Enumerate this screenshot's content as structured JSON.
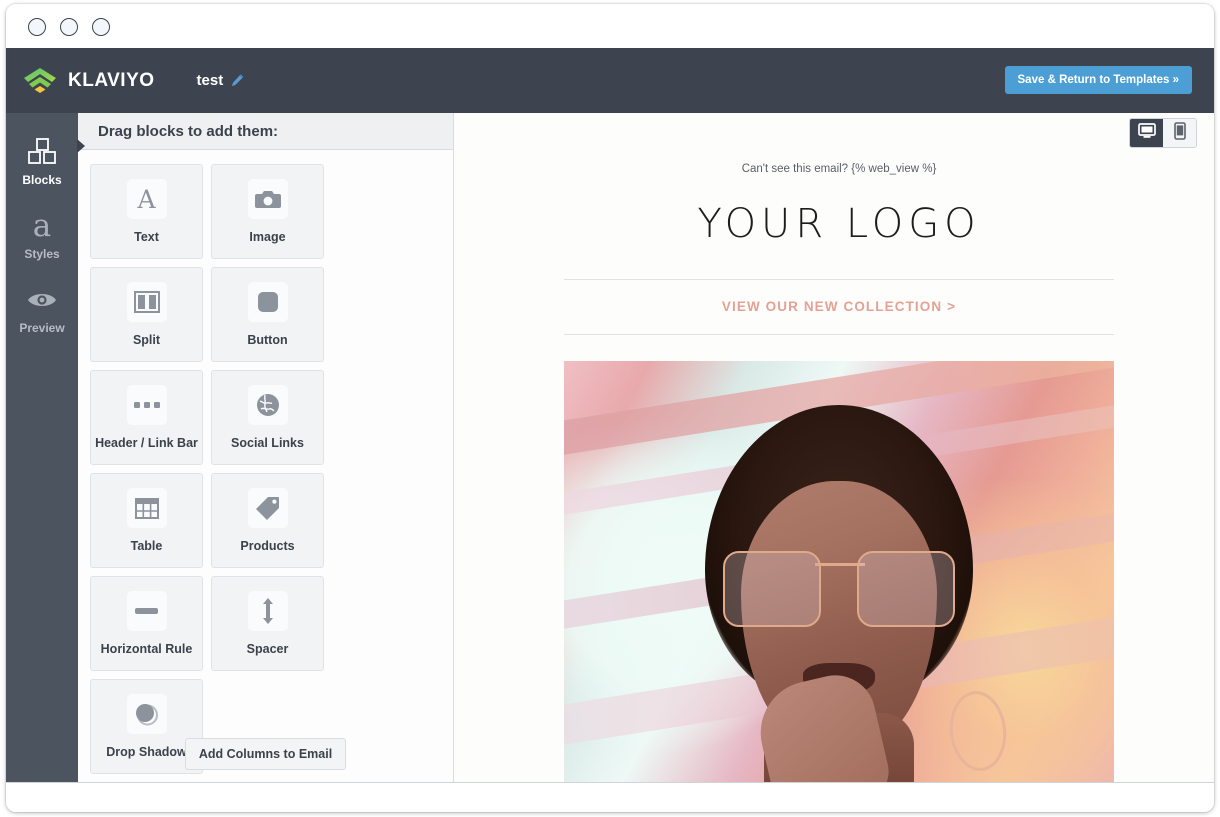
{
  "window": {
    "traffic_lights": [
      "close",
      "minimize",
      "maximize"
    ]
  },
  "appbar": {
    "brand_name": "KLAVIYO",
    "document_name": "test",
    "edit_icon": "pencil-icon",
    "save_label": "Save & Return to Templates »",
    "save_color": "#4b9fd5",
    "background": "#3d444f"
  },
  "rail": {
    "items": [
      {
        "label": "Blocks",
        "icon": "blocks-icon",
        "active": true
      },
      {
        "label": "Styles",
        "icon": "letter-a-icon",
        "active": false
      },
      {
        "label": "Preview",
        "icon": "eye-icon",
        "active": false
      }
    ]
  },
  "panel": {
    "title": "Drag blocks to add them:",
    "add_columns_label": "Add Columns to Email",
    "blocks": [
      {
        "label": "Text",
        "icon": "text-a-icon"
      },
      {
        "label": "Image",
        "icon": "camera-icon"
      },
      {
        "label": "Split",
        "icon": "split-columns-icon"
      },
      {
        "label": "Button",
        "icon": "rounded-square-icon"
      },
      {
        "label": "Header / Link Bar",
        "icon": "three-dots-icon"
      },
      {
        "label": "Social Links",
        "icon": "globe-icon"
      },
      {
        "label": "Table",
        "icon": "table-grid-icon"
      },
      {
        "label": "Products",
        "icon": "price-tag-icon"
      },
      {
        "label": "Horizontal Rule",
        "icon": "horizontal-bar-icon"
      },
      {
        "label": "Spacer",
        "icon": "up-down-arrow-icon"
      },
      {
        "label": "Drop Shadow",
        "icon": "circle-shadow-icon"
      }
    ]
  },
  "preview": {
    "device_toggle": [
      {
        "name": "desktop",
        "icon": "monitor-icon",
        "active": true
      },
      {
        "name": "mobile",
        "icon": "phone-icon",
        "active": false
      }
    ],
    "email": {
      "preheader": "Can't see this email? {% web_view %}",
      "logo_text": "YOUR LOGO",
      "nav_link": "VIEW OUR NEW COLLECTION >",
      "nav_link_color": "#e5a193",
      "hero_image_alt": "Portrait of a woman wearing aviator glasses and hoop earrings against a pink and mint gradient backdrop"
    }
  }
}
